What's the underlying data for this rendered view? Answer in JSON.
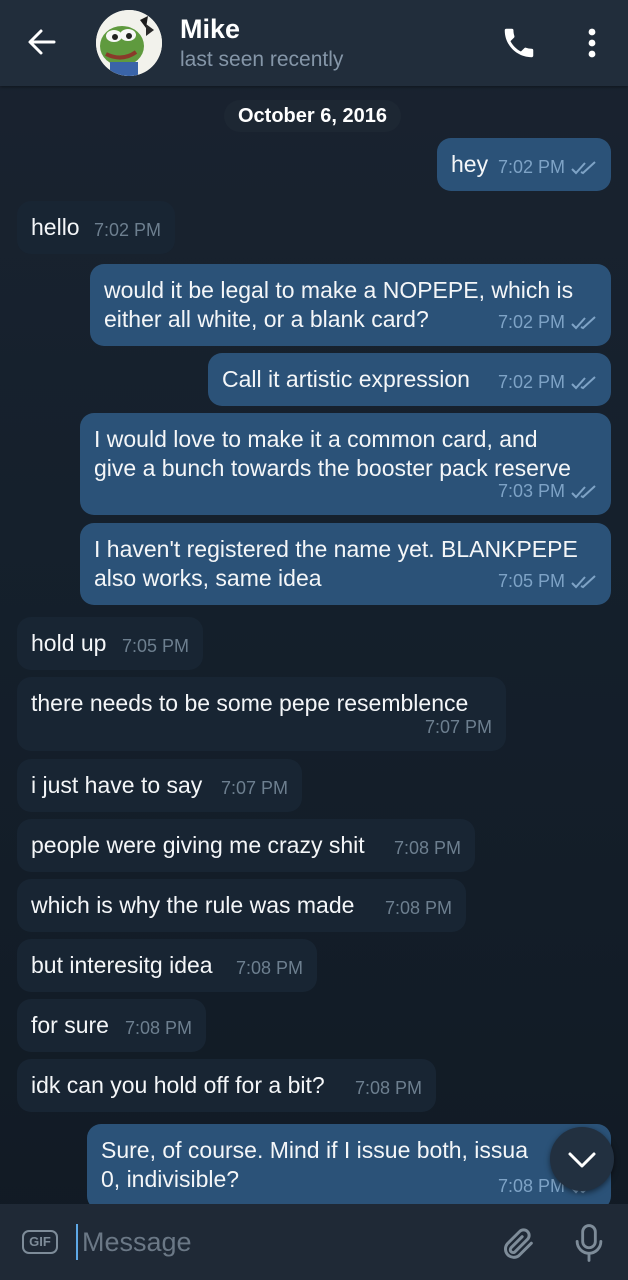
{
  "header": {
    "name": "Mike",
    "status": "last seen recently",
    "avatar_icon": "pepe-frog-avatar"
  },
  "chat": {
    "date_label": "October 6, 2016",
    "messages": [
      {
        "dir": "out",
        "text": "hey",
        "time": "7:02 PM",
        "read": true
      },
      {
        "dir": "in",
        "text": "hello",
        "time": "7:02 PM"
      },
      {
        "dir": "out",
        "text": "would it be legal to make a NOPEPE, which is\neither all white, or a blank card?",
        "time": "7:02 PM",
        "read": true
      },
      {
        "dir": "out",
        "text": "Call it artistic expression",
        "time": "7:02 PM",
        "read": true
      },
      {
        "dir": "out",
        "text": "I would love to make it a common card, and\ngive a bunch towards the booster pack reserve",
        "time": "7:03 PM",
        "read": true
      },
      {
        "dir": "out",
        "text": "I haven't registered the name yet. BLANKPEPE\nalso works, same idea",
        "time": "7:05 PM",
        "read": true
      },
      {
        "dir": "in",
        "text": "hold up",
        "time": "7:05 PM"
      },
      {
        "dir": "in",
        "text": "there needs to be some pepe resemblence",
        "time": "7:07 PM"
      },
      {
        "dir": "in",
        "text": "i just have to say",
        "time": "7:07 PM"
      },
      {
        "dir": "in",
        "text": "people were giving me crazy shit",
        "time": "7:08 PM"
      },
      {
        "dir": "in",
        "text": "which is why the rule was made",
        "time": "7:08 PM"
      },
      {
        "dir": "in",
        "text": "but interesitg idea",
        "time": "7:08 PM"
      },
      {
        "dir": "in",
        "text": "for sure",
        "time": "7:08 PM"
      },
      {
        "dir": "in",
        "text": "idk can you hold off for a bit?",
        "time": "7:08 PM"
      },
      {
        "dir": "out",
        "text": "Sure, of course. Mind if I issue both, issua\n0, indivisible?",
        "time": "7:08 PM",
        "read": true
      }
    ]
  },
  "composer": {
    "gif_label": "GIF",
    "placeholder": "Message"
  },
  "colors": {
    "header_bg": "#212d3b",
    "outgoing_bubble": "#2b5278",
    "incoming_bubble": "#182533",
    "accent": "#5ea8e6"
  }
}
